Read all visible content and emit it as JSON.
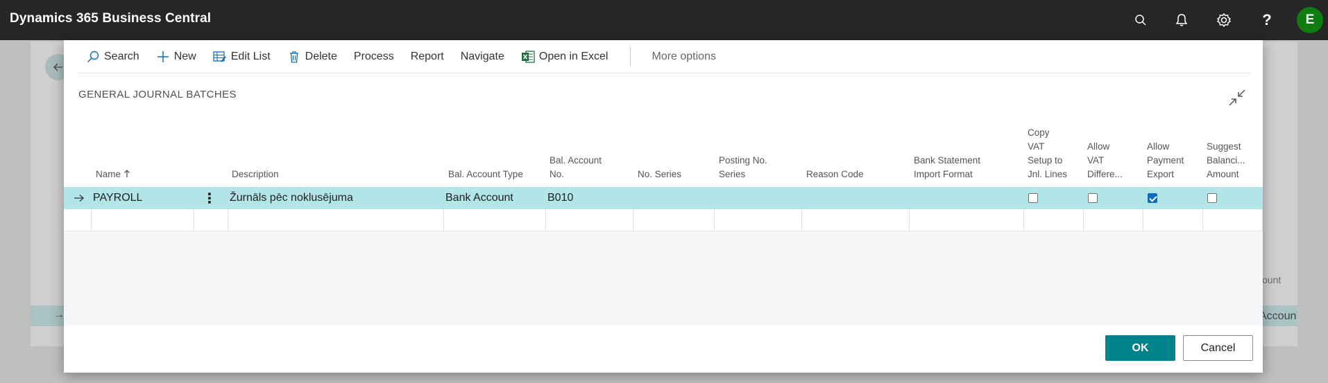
{
  "app": {
    "title": "Dynamics 365 Business Central",
    "user_initial": "E"
  },
  "topbar_icons": [
    "search-icon",
    "bell-icon",
    "gear-icon",
    "help-icon"
  ],
  "background_page": {
    "column_fragment": "count",
    "row_fragment": "Accoun"
  },
  "actions": {
    "search": "Search",
    "new": "New",
    "edit_list": "Edit List",
    "delete": "Delete",
    "process": "Process",
    "report": "Report",
    "navigate": "Navigate",
    "open_in_excel": "Open in Excel",
    "more_options": "More options"
  },
  "dialog": {
    "title": "GENERAL JOURNAL BATCHES"
  },
  "columns": {
    "name": "Name",
    "description": "Description",
    "bal_account_type": "Bal. Account Type",
    "bal_account_no_1": "Bal. Account",
    "bal_account_no_2": "No.",
    "no_series": "No. Series",
    "posting_no_series_1": "Posting No.",
    "posting_no_series_2": "Series",
    "reason_code": "Reason Code",
    "bank_stmt_1": "Bank Statement",
    "bank_stmt_2": "Import Format",
    "copy_vat_1": "Copy",
    "copy_vat_2": "VAT",
    "copy_vat_3": "Setup to",
    "copy_vat_4": "Jnl. Lines",
    "allow_vat_1": "Allow",
    "allow_vat_2": "VAT",
    "allow_vat_3": "Differe...",
    "allow_payment_1": "Allow",
    "allow_payment_2": "Payment",
    "allow_payment_3": "Export",
    "suggest_bal_1": "Suggest",
    "suggest_bal_2": "Balanci...",
    "suggest_bal_3": "Amount"
  },
  "sort": {
    "name_direction": "ascending"
  },
  "rows": [
    {
      "name": "PAYROLL",
      "description": "Žurnāls pēc noklusējuma",
      "bal_account_type": "Bank Account",
      "bal_account_no": "B010",
      "no_series": "",
      "posting_no_series": "",
      "reason_code": "",
      "bank_statement_import_format": "",
      "copy_vat_setup": false,
      "allow_vat_difference": false,
      "allow_payment_export": true,
      "suggest_balancing_amount": false
    }
  ],
  "footer": {
    "ok": "OK",
    "cancel": "Cancel"
  },
  "colors": {
    "topbar": "#262626",
    "accent": "#00838a",
    "selected_row": "#b2e5e7",
    "avatar": "#107c10"
  }
}
